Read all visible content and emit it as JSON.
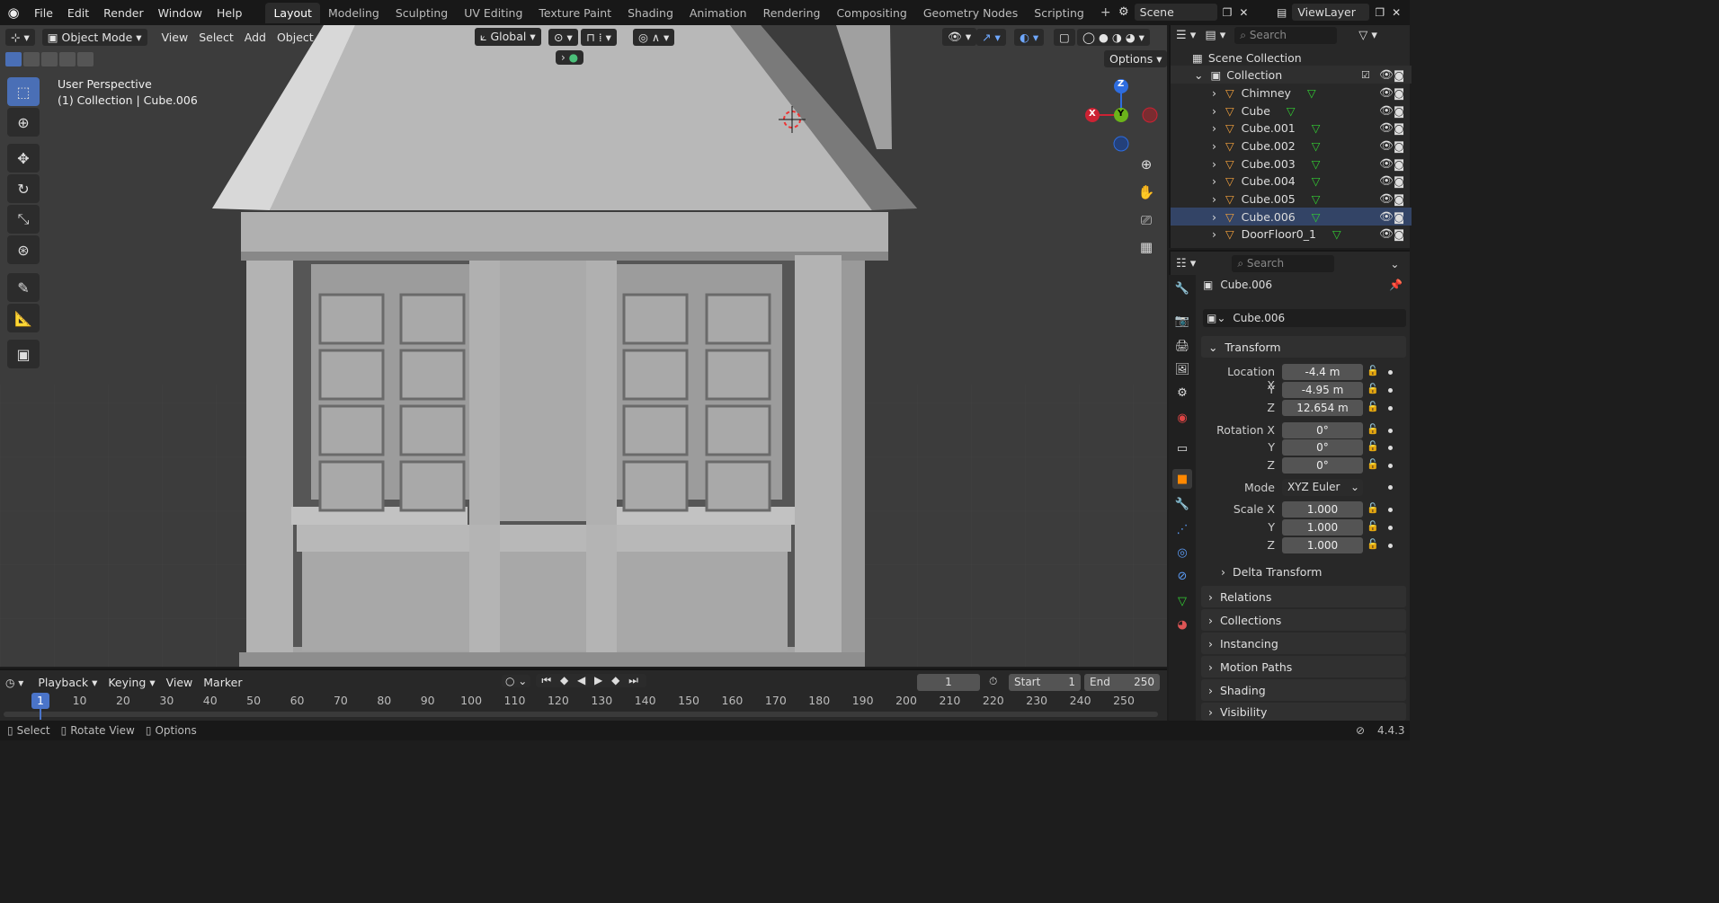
{
  "topbar": {
    "menus": [
      "File",
      "Edit",
      "Render",
      "Window",
      "Help"
    ],
    "workspaces": [
      "Layout",
      "Modeling",
      "Sculpting",
      "UV Editing",
      "Texture Paint",
      "Shading",
      "Animation",
      "Rendering",
      "Compositing",
      "Geometry Nodes",
      "Scripting"
    ],
    "active_workspace": "Layout",
    "scene": "Scene",
    "view_layer": "ViewLayer"
  },
  "viewport_header": {
    "mode": "Object Mode",
    "menus": [
      "View",
      "Select",
      "Add",
      "Object"
    ],
    "orientation": "Global",
    "options": "Options"
  },
  "viewport": {
    "perspective": "User Perspective",
    "context": "(1) Collection | Cube.006"
  },
  "gizmo": {
    "z": "Z",
    "y": "Y",
    "x": "X"
  },
  "outliner": {
    "search_placeholder": "Search",
    "root": "Scene Collection",
    "collection": "Collection",
    "items": [
      "Chimney",
      "Cube",
      "Cube.001",
      "Cube.002",
      "Cube.003",
      "Cube.004",
      "Cube.005",
      "Cube.006",
      "DoorFloor0_1"
    ]
  },
  "properties": {
    "search_placeholder": "Search",
    "object_name": "Cube.006",
    "datablock": "Cube.006",
    "transform_title": "Transform",
    "location": {
      "label": "Location X",
      "x": "-4.4 m",
      "y": "-4.95 m",
      "z": "12.654 m"
    },
    "rotation": {
      "label": "Rotation X",
      "x": "0°",
      "y": "0°",
      "z": "0°"
    },
    "axis_y": "Y",
    "axis_z": "Z",
    "mode_label": "Mode",
    "mode_value": "XYZ Euler",
    "scale": {
      "label": "Scale X",
      "x": "1.000",
      "y": "1.000",
      "z": "1.000"
    },
    "delta": "Delta Transform",
    "panels": [
      "Relations",
      "Collections",
      "Instancing",
      "Motion Paths",
      "Shading",
      "Visibility"
    ]
  },
  "timeline": {
    "menus": [
      "Playback",
      "Keying",
      "View",
      "Marker"
    ],
    "current_frame": "1",
    "start_label": "Start",
    "start": "1",
    "end_label": "End",
    "end": "250",
    "ticks": [
      "1",
      "10",
      "20",
      "30",
      "40",
      "50",
      "60",
      "70",
      "80",
      "90",
      "100",
      "110",
      "120",
      "130",
      "140",
      "150",
      "160",
      "170",
      "180",
      "190",
      "200",
      "210",
      "220",
      "230",
      "240",
      "250"
    ]
  },
  "statusbar": {
    "select": "Select",
    "rotate": "Rotate View",
    "options": "Options",
    "version": "4.4.3"
  }
}
